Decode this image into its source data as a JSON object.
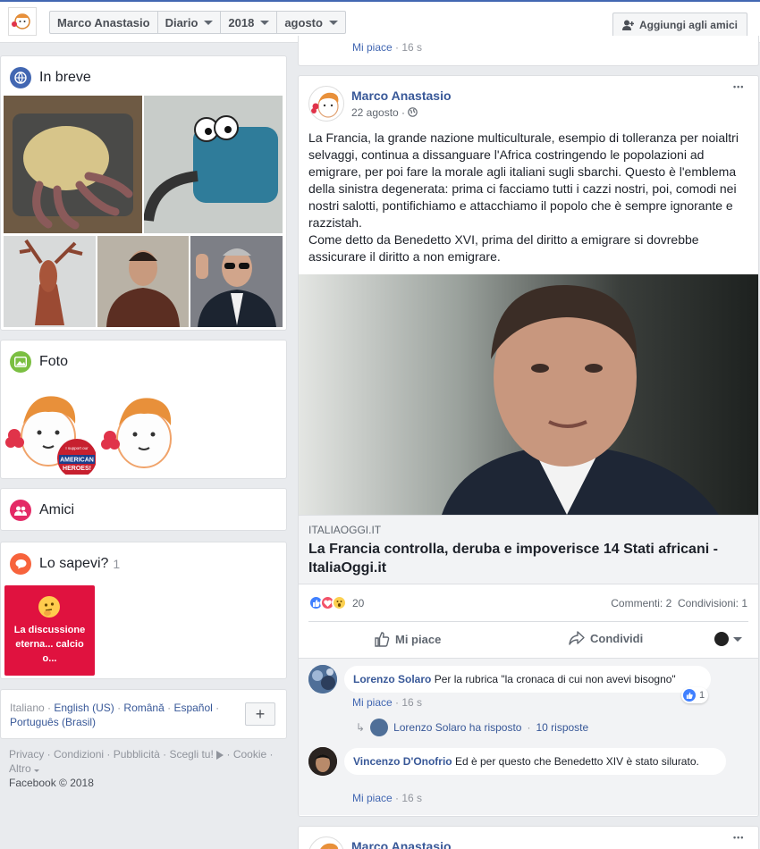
{
  "topbar": {
    "crumbs": [
      "Marco Anastasio",
      "Diario",
      "2018",
      "agosto"
    ],
    "add_friend_label": "Aggiungi agli amici"
  },
  "intro": {
    "title": "In breve"
  },
  "photos": {
    "title": "Foto",
    "badge_lines": [
      "I support our",
      "AMERICAN",
      "HEROES!"
    ]
  },
  "friends": {
    "title": "Amici"
  },
  "didyouknow": {
    "title": "Lo sapevi?",
    "count": "1",
    "card_text": "La discussione eterna... calcio o..."
  },
  "languages": {
    "current": "Italiano",
    "others": [
      "English (US)",
      "Română",
      "Español",
      "Português (Brasil)"
    ],
    "sep": " · "
  },
  "footer": {
    "links": [
      "Privacy",
      "Condizioni",
      "Pubblicità",
      "Scegli tu!",
      "Cookie",
      "Altro"
    ],
    "copyright": "Facebook © 2018"
  },
  "prev_post": {
    "like": "Mi piace",
    "time": "16 s"
  },
  "post": {
    "author": "Marco Anastasio",
    "date": "22 agosto",
    "more": "•••",
    "paragraphs": [
      "La Francia, la grande nazione multiculturale, esempio di tolleranza per noialtri selvaggi, continua a dissanguare l'Africa costringendo le popolazioni ad emigrare, per poi fare la morale agli italiani sugli sbarchi. Questo è l'emblema della sinistra degenerata: prima ci facciamo tutti i cazzi nostri, poi, comodi nei nostri salotti, pontifichiamo e attacchiamo il popolo che è sempre ignorante e razzistah.",
      "Come detto da Benedetto XVI, prima del diritto a emigrare si dovrebbe assicurare il diritto a non emigrare."
    ],
    "link_source": "ITALIAOGGI.IT",
    "link_title": "La Francia controlla, deruba e impoverisce 14 Stati africani - ItaliaOggi.it",
    "reactions_count": "20",
    "comments_stat": "Commenti: 2",
    "shares_stat": "Condivisioni: 1",
    "action_like": "Mi piace",
    "action_share": "Condividi"
  },
  "comments": [
    {
      "author": "Lorenzo Solaro",
      "text": "Per la rubrica \"la cronaca di cui non avevi bisogno\"",
      "like": "Mi piace",
      "time": "16 s",
      "likes": "1"
    },
    {
      "author": "Vincenzo D'Onofrio",
      "text": "Ed è per questo che Benedetto XIV è stato silurato.",
      "like": "Mi piace",
      "time": "16 s"
    }
  ],
  "reply_summary": {
    "who": "Lorenzo Solaro ha risposto",
    "count": "10 risposte"
  },
  "next_post": {
    "author": "Marco Anastasio"
  },
  "colors": {
    "fb_blue": "#4267b2",
    "link_blue": "#385898",
    "background": "#e9ebee"
  }
}
